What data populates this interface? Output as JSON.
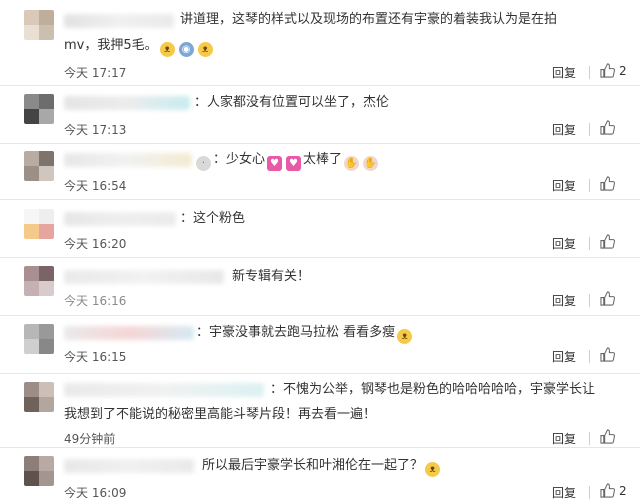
{
  "colors": {
    "text": "#333333",
    "time": "#555555",
    "divider": "#e6e6e6",
    "background": "#ffffff"
  },
  "comments": [
    {
      "text": "讲道理，这琴的样式以及现场的布置还有宇豪的着装我认为是在拍",
      "text2": "mv，我押5毛。",
      "time": "今天 17:17",
      "reply": "回复",
      "likes": "2"
    },
    {
      "text": "：人家都没有位置可以坐了，杰伦",
      "time": "今天 17:13",
      "reply": "回复",
      "likes": ""
    },
    {
      "text": "：少女心",
      "text_after_hearts": "太棒了",
      "time": "今天 16:54",
      "reply": "回复",
      "likes": ""
    },
    {
      "text": "：这个粉色",
      "time": "今天 16:20",
      "reply": "回复",
      "likes": ""
    },
    {
      "text": "新专辑有关！",
      "time": "今天 16:16",
      "reply": "回复",
      "likes": ""
    },
    {
      "text": "：宇豪没事就去跑马拉松 看看多瘦",
      "time": "今天 16:15",
      "reply": "回复",
      "likes": ""
    },
    {
      "text": "：不愧为公举，钢琴也是粉色的哈哈哈哈哈，宇豪学长让",
      "text2": "我想到了不能说的秘密里高能斗琴片段！再去看一遍！",
      "time": "49分钟前",
      "reply": "回复",
      "likes": ""
    },
    {
      "text": "所以最后宇豪学长和叶湘伦在一起了？",
      "time": "今天 16:09",
      "reply": "回复",
      "likes": "2"
    }
  ]
}
